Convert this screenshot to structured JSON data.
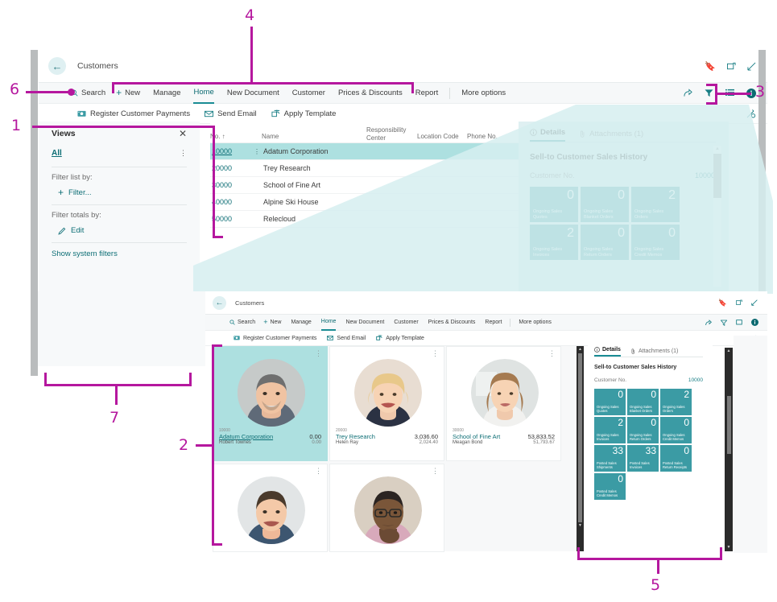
{
  "meta": {
    "accent": "#177d84",
    "callout_color": "#b5179e",
    "tile_color": "#3b9ba4",
    "selected_row_color": "#ade0e0"
  },
  "callouts": [
    {
      "id": "1",
      "label": "1"
    },
    {
      "id": "2",
      "label": "2"
    },
    {
      "id": "3",
      "label": "3"
    },
    {
      "id": "4",
      "label": "4"
    },
    {
      "id": "5",
      "label": "5"
    },
    {
      "id": "6",
      "label": "6"
    },
    {
      "id": "7",
      "label": "7"
    }
  ],
  "window_top": {
    "title": "Customers",
    "back_icon": "back-arrow-icon",
    "window_icons": [
      "bookmark-icon",
      "open-in-new-window-icon",
      "collapse-icon"
    ],
    "ribbon": {
      "search_label": "Search",
      "new_label": "New",
      "items": [
        "Manage",
        "Home",
        "New Document",
        "Customer",
        "Prices & Discounts",
        "Report"
      ],
      "active_item": "Home",
      "more_options": "More options",
      "right_icons": [
        "share-icon",
        "filter-icon",
        "list-view-icon",
        "info-icon"
      ]
    },
    "ribbon2": {
      "items": [
        {
          "label": "Register Customer Payments",
          "icon": "register-payment-icon"
        },
        {
          "label": "Send Email",
          "icon": "email-icon"
        },
        {
          "label": "Apply Template",
          "icon": "apply-template-icon"
        }
      ],
      "right_icon": "personalize-icon"
    },
    "views": {
      "title": "Views",
      "close_icon": "close-icon",
      "all_label": "All",
      "kebab_icon": "more-menu-icon",
      "filter_list_label": "Filter list by:",
      "filter_action": "Filter...",
      "filter_totals_label": "Filter totals by:",
      "edit_action": "Edit",
      "show_system_filters": "Show system filters"
    },
    "list": {
      "columns": [
        "No. ↑",
        "Name",
        "Responsibility Center",
        "Location Code",
        "Phone No."
      ],
      "rows": [
        {
          "no": "10000",
          "name": "Adatum Corporation",
          "selected": true
        },
        {
          "no": "20000",
          "name": "Trey Research",
          "selected": false
        },
        {
          "no": "30000",
          "name": "School of Fine Art",
          "selected": false
        },
        {
          "no": "40000",
          "name": "Alpine Ski House",
          "selected": false
        },
        {
          "no": "50000",
          "name": "Relecloud",
          "selected": false
        }
      ]
    },
    "factbox": {
      "tabs": [
        {
          "label": "Details",
          "icon": "info-circle-icon",
          "active": true
        },
        {
          "label": "Attachments (1)",
          "icon": "paperclip-icon",
          "active": false
        }
      ],
      "heading": "Sell-to Customer Sales History",
      "field_label": "Customer No.",
      "field_value": "10000",
      "tiles": [
        {
          "value": "0",
          "caption": "Ongoing Sales Quotes"
        },
        {
          "value": "0",
          "caption": "Ongoing Sales Blanket Orders"
        },
        {
          "value": "2",
          "caption": "Ongoing Sales Orders"
        },
        {
          "value": "2",
          "caption": "Ongoing Sales Invoices"
        },
        {
          "value": "0",
          "caption": "Ongoing Sales Return Orders"
        },
        {
          "value": "0",
          "caption": "Ongoing Sales Credit Memos"
        }
      ]
    }
  },
  "window_bottom": {
    "title": "Customers",
    "back_icon": "back-arrow-icon",
    "window_icons": [
      "bookmark-icon",
      "open-in-new-window-icon",
      "collapse-icon"
    ],
    "ribbon": {
      "search_label": "Search",
      "new_label": "New",
      "items": [
        "Manage",
        "Home",
        "New Document",
        "Customer",
        "Prices & Discounts",
        "Report"
      ],
      "active_item": "Home",
      "more_options": "More options",
      "right_icons": [
        "share-icon",
        "filter-icon",
        "list-view-icon",
        "info-icon"
      ]
    },
    "ribbon2": {
      "items": [
        {
          "label": "Register Customer Payments",
          "icon": "register-payment-icon"
        },
        {
          "label": "Send Email",
          "icon": "email-icon"
        },
        {
          "label": "Apply Template",
          "icon": "apply-template-icon"
        }
      ],
      "right_icon": "personalize-icon"
    },
    "gallery": {
      "cards": [
        {
          "no": "10000",
          "name": "Adatum Corporation",
          "contact": "Robert Townes",
          "amount": "0.00",
          "amount2": "0.00",
          "selected": true,
          "avatar": "man-grey-hair-photo"
        },
        {
          "no": "20000",
          "name": "Trey Research",
          "contact": "Helen Ray",
          "amount": "3,036.60",
          "amount2": "2,024.40",
          "selected": false,
          "avatar": "woman-blonde-photo"
        },
        {
          "no": "30000",
          "name": "School of Fine Art",
          "contact": "Meagan Bond",
          "amount": "53,833.52",
          "amount2": "51,793.67",
          "selected": false,
          "avatar": "woman-brunette-photo"
        },
        {
          "no": "",
          "name": "",
          "contact": "",
          "amount": "",
          "amount2": "",
          "selected": false,
          "avatar": "man-smiling-photo"
        },
        {
          "no": "",
          "name": "",
          "contact": "",
          "amount": "",
          "amount2": "",
          "selected": false,
          "avatar": "man-glasses-photo"
        }
      ]
    },
    "factbox": {
      "tabs": [
        {
          "label": "Details",
          "icon": "info-circle-icon",
          "active": true
        },
        {
          "label": "Attachments (1)",
          "icon": "paperclip-icon",
          "active": false
        }
      ],
      "heading": "Sell-to Customer Sales History",
      "field_label": "Customer No.",
      "field_value": "10000",
      "tiles": [
        {
          "value": "0",
          "caption": "Ongoing Sales Quotes"
        },
        {
          "value": "0",
          "caption": "Ongoing Sales Blanket Orders"
        },
        {
          "value": "2",
          "caption": "Ongoing Sales Orders"
        },
        {
          "value": "2",
          "caption": "Ongoing Sales Invoices"
        },
        {
          "value": "0",
          "caption": "Ongoing Sales Return Orders"
        },
        {
          "value": "0",
          "caption": "Ongoing Sales Credit Memos"
        },
        {
          "value": "33",
          "caption": "Posted Sales Shipments"
        },
        {
          "value": "33",
          "caption": "Posted Sales Invoices"
        },
        {
          "value": "0",
          "caption": "Posted Sales Return Receipts"
        },
        {
          "value": "0",
          "caption": "Posted Sales Credit Memos"
        }
      ]
    }
  }
}
